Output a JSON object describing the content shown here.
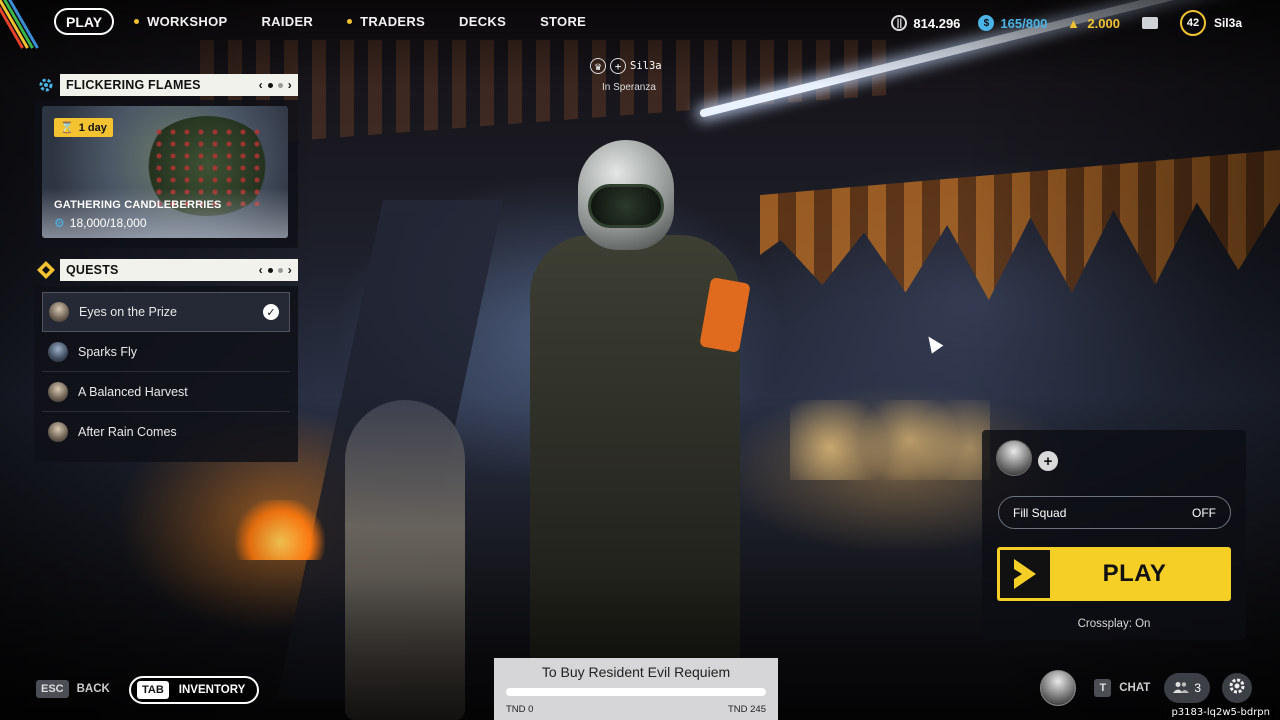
{
  "nav": {
    "play_label": "PLAY",
    "items": [
      {
        "label": "WORKSHOP",
        "dot": true
      },
      {
        "label": "RAIDER",
        "dot": false
      },
      {
        "label": "TRADERS",
        "dot": true
      },
      {
        "label": "DECKS",
        "dot": false
      },
      {
        "label": "STORE",
        "dot": false
      }
    ],
    "currencies": {
      "coins": "814.296",
      "tokens": "165/800",
      "gold": "2.000"
    },
    "level": "42",
    "username": "Sil3a"
  },
  "event": {
    "title": "FLICKERING FLAMES",
    "timer": "1 day",
    "name": "GATHERING CANDLEBERRIES",
    "progress": "18,000/18,000"
  },
  "quests": {
    "title": "QUESTS",
    "items": [
      {
        "label": "Eyes on the Prize",
        "completed": true
      },
      {
        "label": "Sparks Fly",
        "completed": false
      },
      {
        "label": "A Balanced Harvest",
        "completed": false
      },
      {
        "label": "After Rain Comes",
        "completed": false
      }
    ]
  },
  "player_tag": {
    "name": "Sil3a",
    "location": "In Speranza"
  },
  "squad": {
    "fill_label": "Fill Squad",
    "fill_value": "OFF",
    "play_label": "PLAY",
    "crossplay": "Crossplay: On"
  },
  "bottom": {
    "back_key": "ESC",
    "back_label": "BACK",
    "inventory_key": "TAB",
    "inventory_label": "INVENTORY",
    "chat_key": "T",
    "chat_label": "CHAT",
    "friends_count": "3",
    "session_id": "p3183-lq2w5-bdrpn"
  },
  "purchase": {
    "title": "To Buy Resident Evil Requiem",
    "min_label": "TND 0",
    "max_label": "TND 245",
    "progress_fraction": 0.0
  },
  "colors": {
    "accent_yellow": "#f2c230",
    "play_yellow": "#f6cf26",
    "token_blue": "#4bb4e6"
  }
}
